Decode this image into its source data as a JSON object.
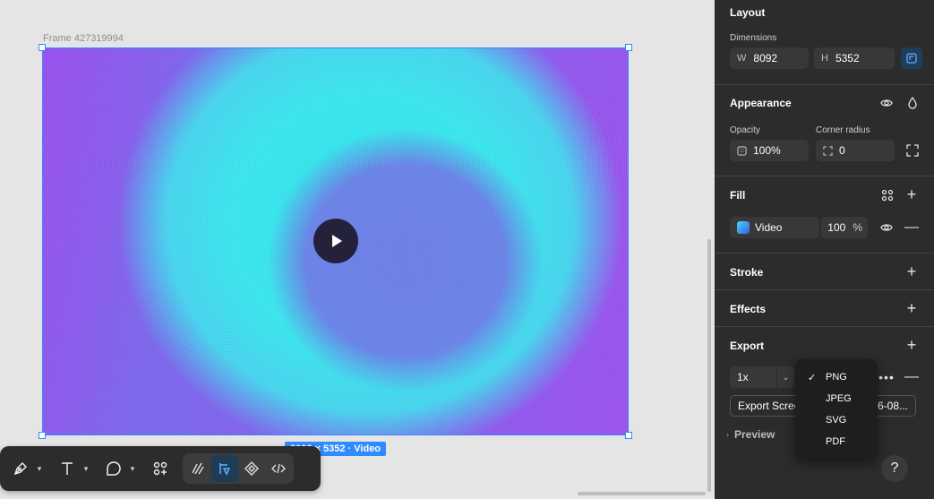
{
  "canvas": {
    "frame_label": "Frame 427319994",
    "size_badge": "8092 × 5352 · Video"
  },
  "toolbar": {
    "tools": [
      "pen-icon",
      "text-icon",
      "shape-icon",
      "components-icon"
    ],
    "modes": [
      "draw-icon",
      "design-icon",
      "prototype-icon",
      "code-icon"
    ]
  },
  "panel": {
    "layout": {
      "title": "Layout",
      "dimensions_label": "Dimensions",
      "w_label": "W",
      "w_value": "8092",
      "h_label": "H",
      "h_value": "5352"
    },
    "appearance": {
      "title": "Appearance",
      "opacity_label": "Opacity",
      "opacity_value": "100%",
      "radius_label": "Corner radius",
      "radius_value": "0"
    },
    "fill": {
      "title": "Fill",
      "type": "Video",
      "opacity": "100",
      "unit": "%"
    },
    "stroke": {
      "title": "Stroke"
    },
    "effects": {
      "title": "Effects"
    },
    "export": {
      "title": "Export",
      "scale": "1x",
      "button_label": "Export Scree",
      "suffix": "6-08...",
      "preview_label": "Preview"
    }
  },
  "format_menu": {
    "selected": "PNG",
    "options": [
      "PNG",
      "JPEG",
      "SVG",
      "PDF"
    ]
  },
  "help": "?",
  "colors": {
    "selection": "#2f8bff",
    "panel_bg": "#2c2c2c",
    "field_bg": "#383838"
  }
}
